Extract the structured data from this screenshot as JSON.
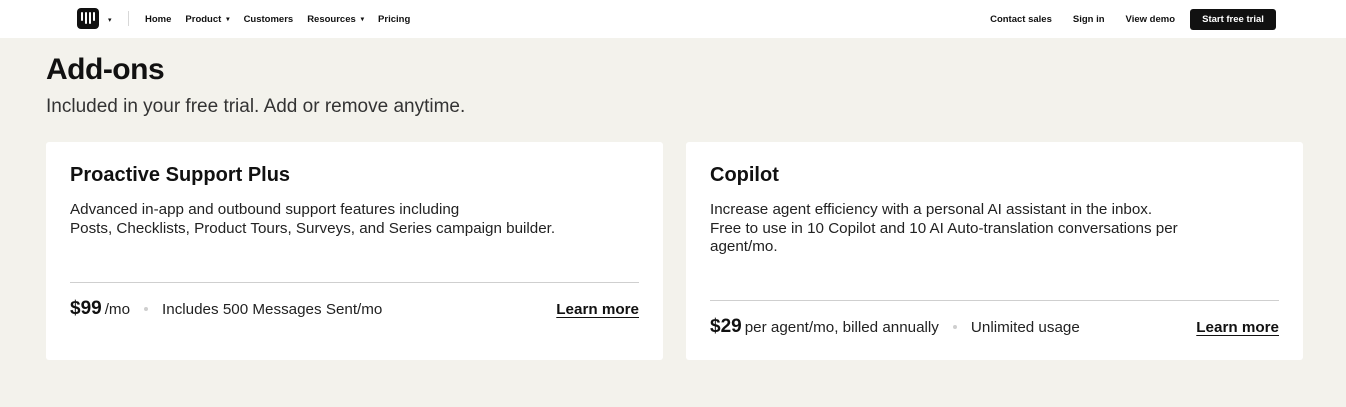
{
  "nav": {
    "links": [
      {
        "label": "Home",
        "has_caret": false
      },
      {
        "label": "Product",
        "has_caret": true
      },
      {
        "label": "Customers",
        "has_caret": false
      },
      {
        "label": "Resources",
        "has_caret": true
      },
      {
        "label": "Pricing",
        "has_caret": false
      }
    ],
    "right_links": [
      {
        "label": "Contact sales"
      },
      {
        "label": "Sign in"
      },
      {
        "label": "View demo"
      }
    ],
    "cta_label": "Start free trial",
    "logo_icon": "intercom-logo-icon",
    "caret_glyph": "▾"
  },
  "main": {
    "title": "Add-ons",
    "subtitle": "Included in your free trial. Add or remove anytime."
  },
  "cards": [
    {
      "title": "Proactive Support Plus",
      "description_lines": [
        "Advanced in-app and outbound support features including",
        "Posts, Checklists, Product Tours, Surveys, and Series campaign builder."
      ],
      "price": "$99",
      "price_unit": "/mo",
      "price_extra": "Includes 500 Messages Sent/mo",
      "learn_more": "Learn more"
    },
    {
      "title": "Copilot",
      "description_lines": [
        "Increase agent efficiency with a personal AI assistant in the inbox.",
        "Free to use in 10 Copilot and 10 AI Auto-translation conversations per",
        "agent/mo."
      ],
      "price": "$29",
      "price_unit": "per agent/mo, billed annually",
      "price_extra": "Unlimited usage",
      "learn_more": "Learn more"
    }
  ],
  "colors": {
    "page_background": "#f3f2ec",
    "card_background": "#ffffff",
    "text": "#111111",
    "cta_background": "#111111"
  }
}
